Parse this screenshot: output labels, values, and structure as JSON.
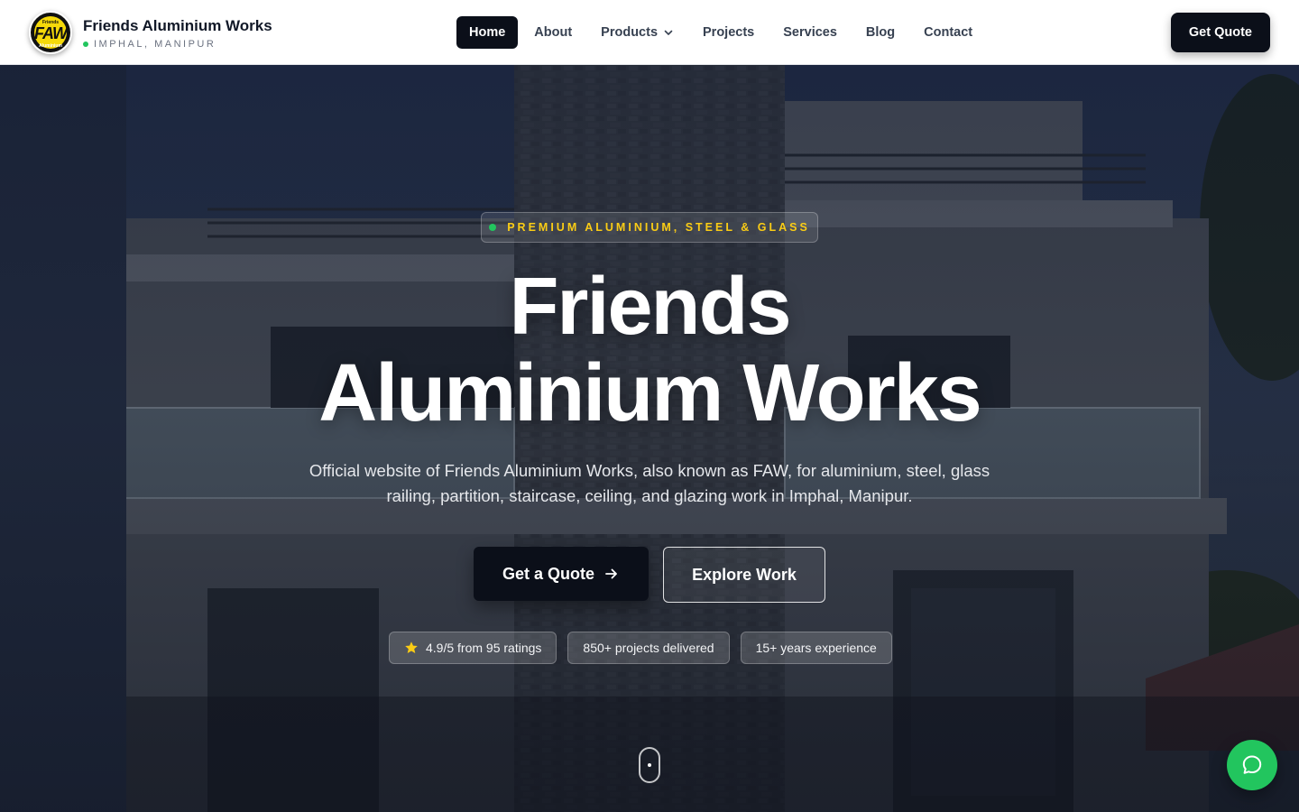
{
  "brand": {
    "name": "Friends Aluminium Works",
    "location": "IMPHAL, MANIPUR",
    "logo": {
      "top": "Friends",
      "mark": "FAW",
      "bottom": "Aluminium"
    }
  },
  "nav": {
    "items": [
      {
        "label": "Home",
        "active": true
      },
      {
        "label": "About"
      },
      {
        "label": "Products",
        "dropdown": true
      },
      {
        "label": "Projects"
      },
      {
        "label": "Services"
      },
      {
        "label": "Blog"
      },
      {
        "label": "Contact"
      }
    ],
    "cta": "Get Quote"
  },
  "hero": {
    "eyebrow": "PREMIUM ALUMINIUM, STEEL & GLASS",
    "title_line1": "Friends",
    "title_line2": "Aluminium Works",
    "subtitle": "Official website of Friends Aluminium Works, also known as FAW, for aluminium, steel, glass railing, partition, staircase, ceiling, and glazing work in Imphal, Manipur.",
    "primary_cta": "Get a Quote",
    "secondary_cta": "Explore Work",
    "stats": [
      "4.9/5 from 95 ratings",
      "850+ projects delivered",
      "15+ years experience"
    ]
  },
  "icons": {
    "star": "star-icon",
    "arrow": "arrow-right-icon",
    "chat": "chat-icon",
    "chevron": "chevron-down-icon"
  },
  "colors": {
    "brand_dark": "#0b0f19",
    "accent_yellow": "#facc15",
    "accent_green": "#22c55e"
  }
}
